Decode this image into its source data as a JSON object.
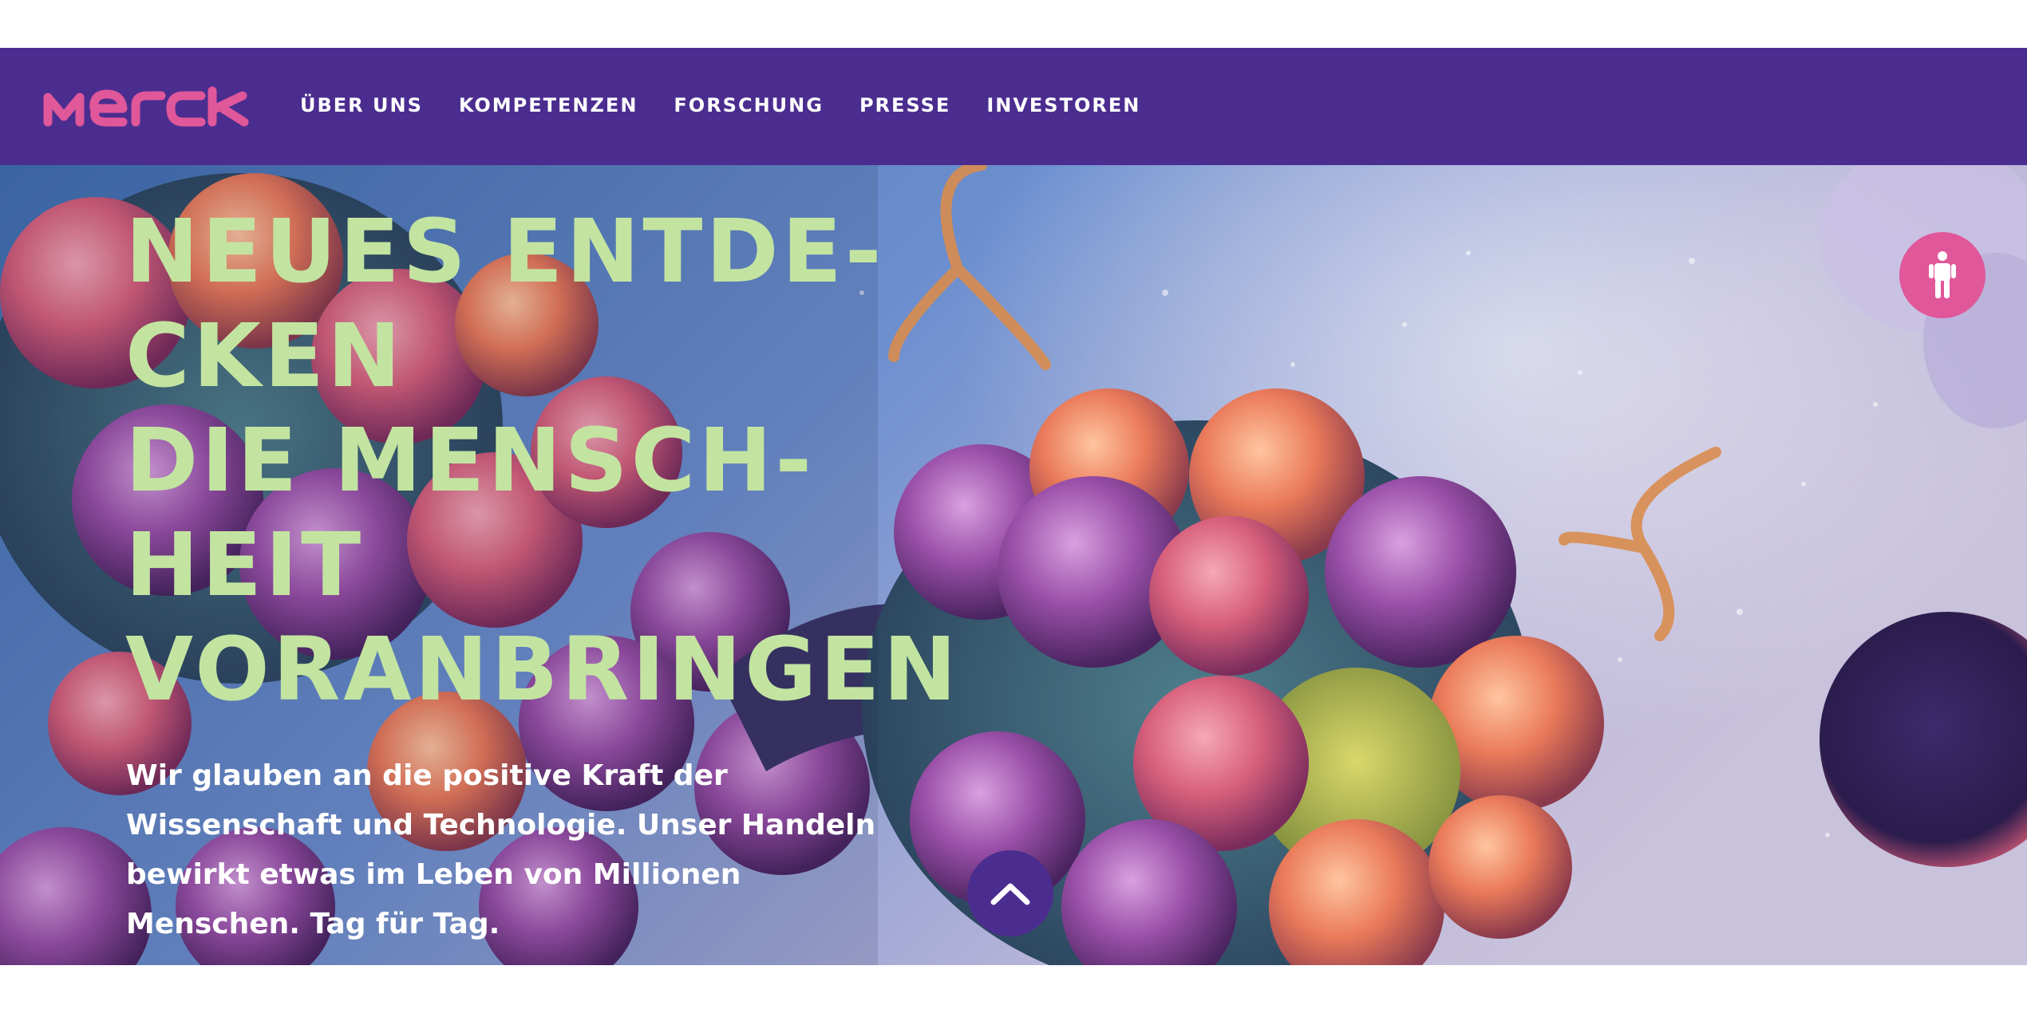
{
  "brand": {
    "logo_text": "Merck",
    "logo_color": "#e0579a",
    "nav_color": "#4b2d8f"
  },
  "nav": {
    "items": [
      {
        "label": "ÜBER UNS"
      },
      {
        "label": "KOMPETENZEN"
      },
      {
        "label": "FORSCHUNG"
      },
      {
        "label": "PRESSE"
      },
      {
        "label": "INVESTOREN"
      }
    ]
  },
  "hero": {
    "headline_lines": [
      "NEUES ENTDE-",
      "CKEN",
      "DIE MENSCH-",
      "HEIT",
      "VORANBRINGEN"
    ],
    "headline_color": "#c3e4a1",
    "subtext_lines": [
      "Wir glauben an die positive Kraft der",
      "Wissenschaft und Technologie. Unser Handeln",
      "bewirkt etwas im Leben von Millionen",
      "Menschen. Tag für Tag."
    ]
  },
  "buttons": {
    "accessibility_icon": "person-accessibility-icon",
    "scroll_icon": "chevron-up-icon"
  }
}
